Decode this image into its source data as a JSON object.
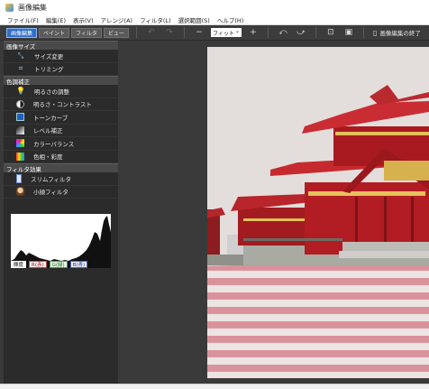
{
  "window": {
    "title": "画像編集"
  },
  "menu": [
    "ファイル(F)",
    "編集(E)",
    "表示(V)",
    "アレンジ(A)",
    "フィルタ(L)",
    "選択範囲(S)",
    "ヘルプ(H)"
  ],
  "toolbar": {
    "modes": [
      "画像編集",
      "ペイント",
      "フィルタ",
      "ビュー"
    ],
    "active_mode": "画像編集",
    "zoom_value": "フィット",
    "exit_label": "画像編集の終了"
  },
  "sidebar": {
    "sections": [
      {
        "title": "画像サイズ",
        "items": [
          {
            "label": "サイズ変更",
            "icon": "resize-icon"
          },
          {
            "label": "トリミング",
            "icon": "crop-icon"
          }
        ]
      },
      {
        "title": "色調補正",
        "items": [
          {
            "label": "明るさの調整",
            "icon": "lightbulb-icon"
          },
          {
            "label": "明るさ・コントラスト",
            "icon": "contrast-icon"
          },
          {
            "label": "トーンカーブ",
            "icon": "tone-curve-icon"
          },
          {
            "label": "レベル補正",
            "icon": "levels-icon"
          },
          {
            "label": "カラーバランス",
            "icon": "color-balance-icon"
          },
          {
            "label": "色相・彩度",
            "icon": "hue-saturation-icon"
          }
        ]
      },
      {
        "title": "フィルタ効果",
        "items": [
          {
            "label": "スリムフィルタ",
            "icon": "slim-filter-icon"
          },
          {
            "label": "小顔フィルタ",
            "icon": "face-filter-icon"
          }
        ]
      }
    ]
  },
  "histogram": {
    "tabs": [
      "輝度",
      "R(赤)",
      "G(緑)",
      "B(青)"
    ],
    "active_tab": "輝度"
  },
  "colors": {
    "active_mode_bg": "#2f6fc9",
    "sidebar_bg": "#2b2b2b",
    "section_header_bg": "#4a4a4a",
    "canvas_bg": "#3a3a3a"
  }
}
